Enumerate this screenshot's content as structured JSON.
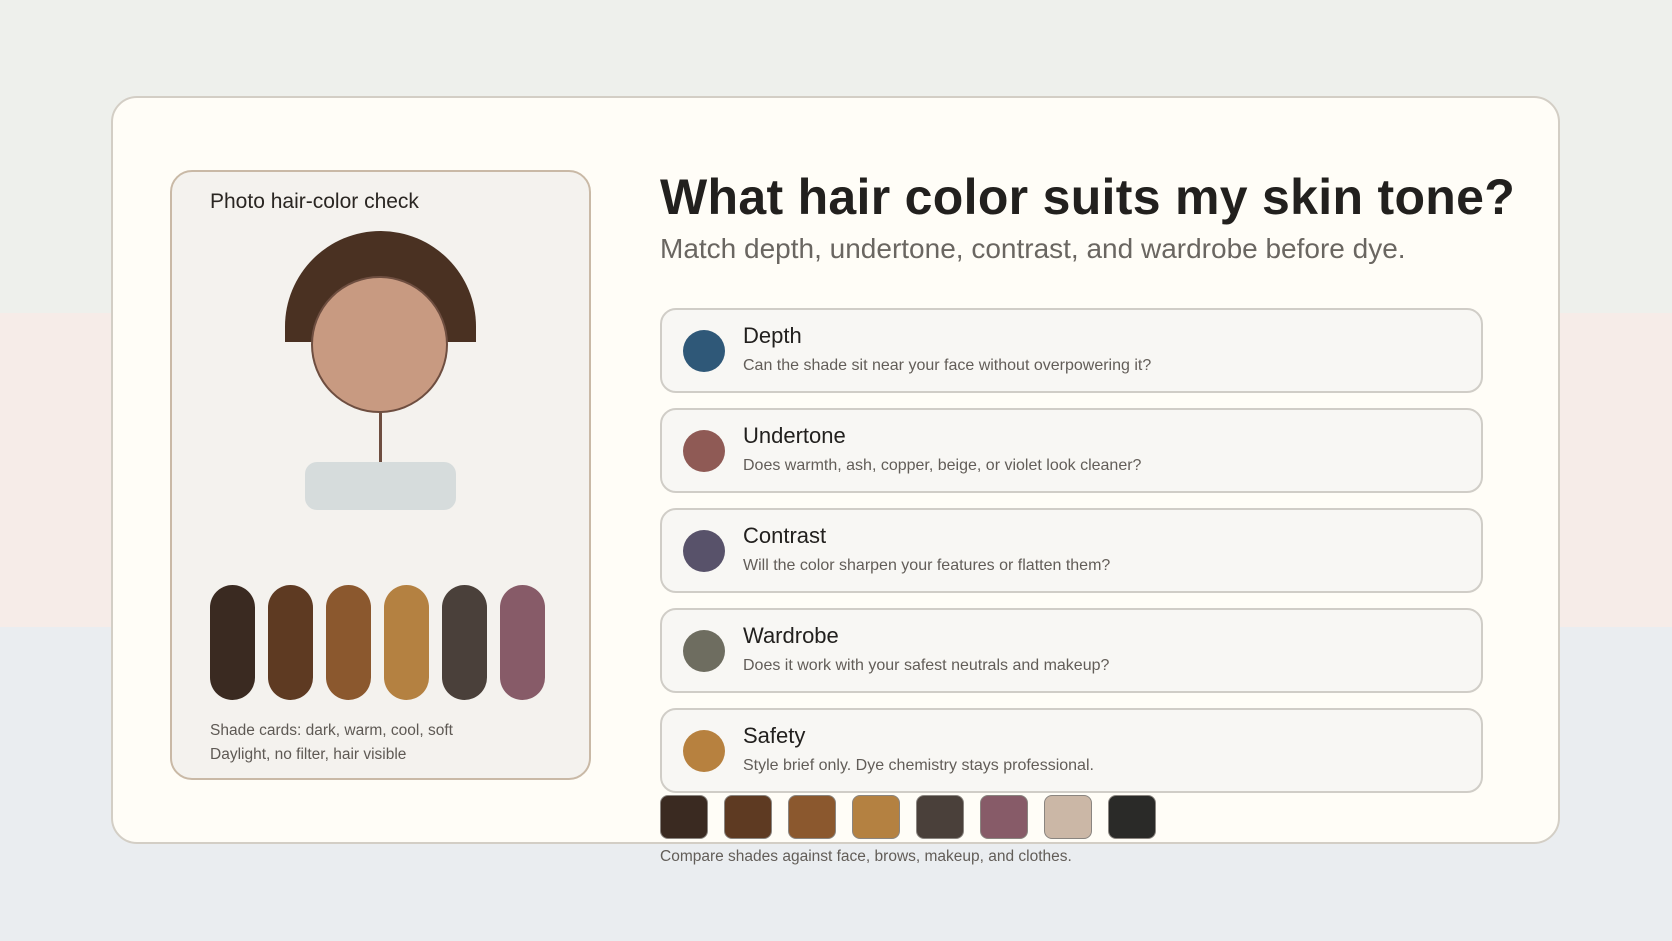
{
  "photo_panel": {
    "title": "Photo hair-color check",
    "hair_color": "#4a3122",
    "skin_color": "#c89a81",
    "shade_pills": [
      {
        "color": "#3a2a21"
      },
      {
        "color": "#5e3a22"
      },
      {
        "color": "#8b582e"
      },
      {
        "color": "#b48141"
      },
      {
        "color": "#4a403a"
      },
      {
        "color": "#875b68"
      }
    ],
    "notes": [
      "Shade cards: dark, warm, cool, soft",
      "Daylight, no filter, hair visible"
    ]
  },
  "header": {
    "title": "What hair color suits my skin tone?",
    "subtitle": "Match depth, undertone, contrast, and wardrobe before dye."
  },
  "criteria": [
    {
      "title": "Depth",
      "description": "Can the shade sit near your face without overpowering it?",
      "color": "#2f5878"
    },
    {
      "title": "Undertone",
      "description": "Does warmth, ash, copper, beige, or violet look cleaner?",
      "color": "#8f5a55"
    },
    {
      "title": "Contrast",
      "description": "Will the color sharpen your features or flatten them?",
      "color": "#58526a"
    },
    {
      "title": "Wardrobe",
      "description": "Does it work with your safest neutrals and makeup?",
      "color": "#6e6d60"
    },
    {
      "title": "Safety",
      "description": "Style brief only. Dye chemistry stays professional.",
      "color": "#b7813f"
    }
  ],
  "swatches": [
    {
      "color": "#3a2a21"
    },
    {
      "color": "#5e3a22"
    },
    {
      "color": "#8b582e"
    },
    {
      "color": "#b48141"
    },
    {
      "color": "#4a403a"
    },
    {
      "color": "#875b68"
    },
    {
      "color": "#cbb7a6"
    },
    {
      "color": "#2a2a28"
    }
  ],
  "compare_note": "Compare shades against face, brows, makeup, and clothes."
}
